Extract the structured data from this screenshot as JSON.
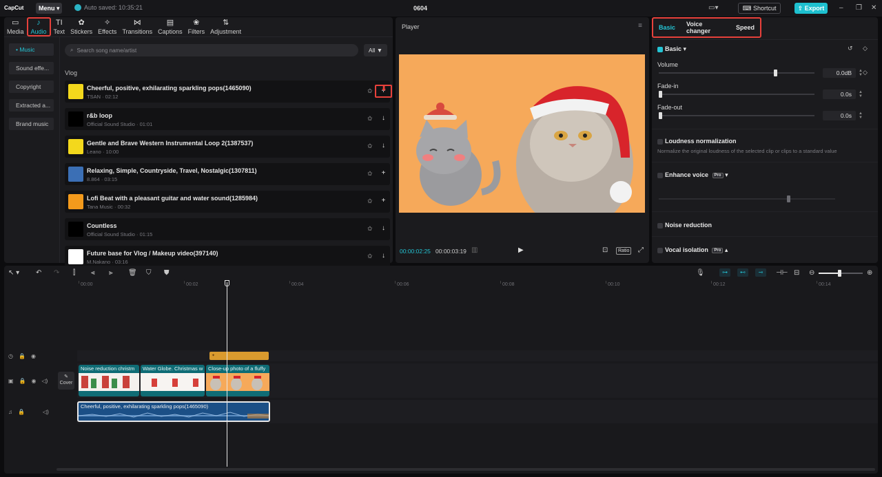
{
  "app": {
    "logo": "CapCut",
    "menu_label": "Menu",
    "autosave": "Auto saved: 10:35:21",
    "project_title": "0604",
    "shortcut_label": "Shortcut",
    "export_label": "Export"
  },
  "tool_tabs": [
    {
      "label": "Media",
      "icon": "media-icon",
      "glyph": "▭"
    },
    {
      "label": "Audio",
      "icon": "audio-icon",
      "glyph": "♪",
      "active": true
    },
    {
      "label": "Text",
      "icon": "text-icon",
      "glyph": "TI"
    },
    {
      "label": "Stickers",
      "icon": "sticker-icon",
      "glyph": "✿"
    },
    {
      "label": "Effects",
      "icon": "effects-icon",
      "glyph": "✧"
    },
    {
      "label": "Transitions",
      "icon": "transitions-icon",
      "glyph": "⋈"
    },
    {
      "label": "Captions",
      "icon": "captions-icon",
      "glyph": "▤"
    },
    {
      "label": "Filters",
      "icon": "filters-icon",
      "glyph": "❀"
    },
    {
      "label": "Adjustment",
      "icon": "adjustment-icon",
      "glyph": "⇅"
    }
  ],
  "categories": [
    {
      "label": "• Music",
      "active": true
    },
    {
      "label": "Sound effe..."
    },
    {
      "label": "Copyright"
    },
    {
      "label": "Extracted a..."
    },
    {
      "label": "Brand music"
    }
  ],
  "search": {
    "placeholder": "Search song name/artist",
    "filter_label": "All"
  },
  "section_title": "Vlog",
  "songs": [
    {
      "name": "Cheerful, positive, exhilarating sparkling pops(1465090)",
      "meta": "TSAN · 02:12",
      "thumb": "#f3d81c",
      "action": "+"
    },
    {
      "name": "r&b loop",
      "meta": "Official Sound Studio · 01:01",
      "thumb": "#000000",
      "action": "↓"
    },
    {
      "name": "Gentle and Brave Western Instrumental Loop 2(1387537)",
      "meta": "Leano · 10:00",
      "thumb": "#f3d81c",
      "action": "↓"
    },
    {
      "name": "Relaxing, Simple, Countryside, Travel, Nostalgic(1307811)",
      "meta": "8.864 · 03:15",
      "thumb": "#3b6fb5",
      "action": "+"
    },
    {
      "name": "Lofi Beat with a pleasant guitar and water sound(1285984)",
      "meta": "Tana Music · 00:32",
      "thumb": "#f39a1c",
      "action": "+"
    },
    {
      "name": "Countless",
      "meta": "Official Sound Studio · 01:15",
      "thumb": "#000000",
      "action": "↓"
    },
    {
      "name": "Future base for Vlog / Makeup video(397140)",
      "meta": "M.Nakano · 03:16",
      "thumb": "#ffffff",
      "action": "↓"
    }
  ],
  "player": {
    "title": "Player",
    "current_time": "00:00:02:25",
    "duration": "00:00:03:19",
    "ratio_label": "Ratio"
  },
  "props": {
    "tabs": [
      {
        "label": "Basic",
        "active": true
      },
      {
        "label": "Voice changer"
      },
      {
        "label": "Speed"
      }
    ],
    "basic_label": "Basic",
    "volume_label": "Volume",
    "volume_value": "0.0dB",
    "volume_level": 0.74,
    "fadein_label": "Fade-in",
    "fadein_value": "0.0s",
    "fadeout_label": "Fade-out",
    "fadeout_value": "0.0s",
    "loudness_label": "Loudness normalization",
    "loudness_desc": "Normalize the original loudness of the selected clip or clips to a standard value",
    "enhance_label": "Enhance voice",
    "noise_label": "Noise reduction",
    "vocal_label": "Vocal isolation",
    "pro_badge": "Pro"
  },
  "timeline": {
    "ticks": [
      "00:00",
      "00:02",
      "00:04",
      "00:06",
      "00:08",
      "00:10",
      "00:12",
      "00:14"
    ],
    "cover_label": "Cover",
    "video_clips": [
      {
        "label": "Noise reduction   christm"
      },
      {
        "label": "Water Globe. Christmas w"
      },
      {
        "label": "Close-up photo of a fluffy"
      }
    ],
    "audio_clip_label": "Cheerful, positive, exhilarating sparkling pops(1465090)"
  },
  "colors": {
    "accent": "#24c4d4",
    "highlight": "#e8413b",
    "export": "#1ec0cf"
  }
}
